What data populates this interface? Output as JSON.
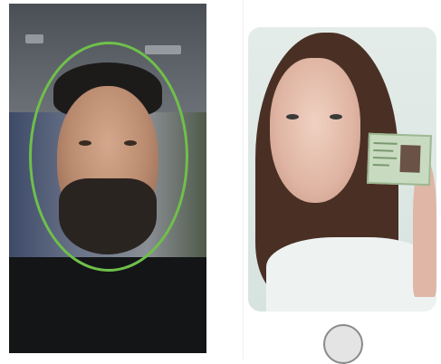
{
  "screens": {
    "left": {
      "kind": "selfie-capture",
      "guide_shape": "oval",
      "guide_color": "#6fc04a"
    },
    "right": {
      "kind": "selfie-with-document",
      "document_color": "#c8dbc0"
    }
  },
  "icons": {
    "home": "home-button-icon"
  }
}
